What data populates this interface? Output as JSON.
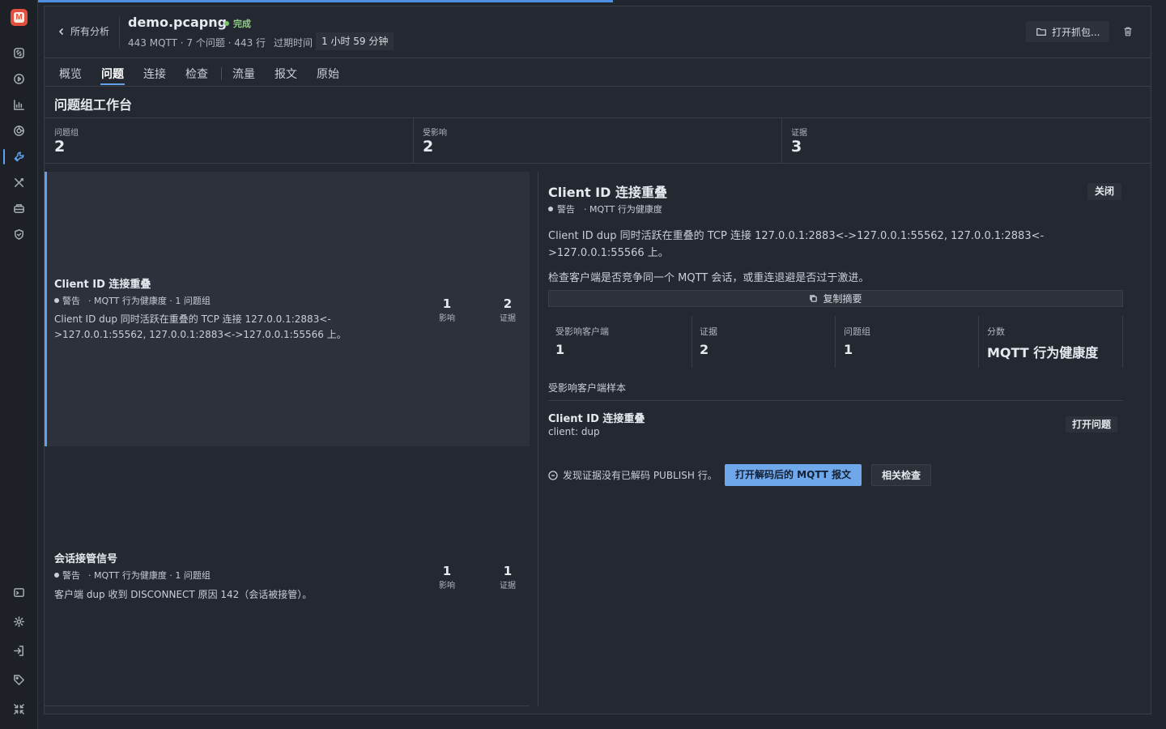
{
  "app": {
    "logo_letter": "M"
  },
  "progress": {
    "fraction": 0.51
  },
  "header": {
    "back_label": "所有分析",
    "file_name": "demo.pcapng",
    "status": "完成",
    "meta": "443 MQTT · 7 个问题 · 443 行",
    "elapsed_label": "过期时间",
    "elapsed_value": "1 小时 59 分钟",
    "open_capture_label": "打开抓包..."
  },
  "tabs": [
    {
      "label": "概览"
    },
    {
      "label": "问题",
      "active": true
    },
    {
      "label": "连接"
    },
    {
      "label": "检查"
    },
    {
      "label": "流量"
    },
    {
      "label": "报文"
    },
    {
      "label": "原始"
    }
  ],
  "page_title": "问题组工作台",
  "stats": [
    {
      "label": "问题组",
      "value": "2"
    },
    {
      "label": "受影响",
      "value": "2"
    },
    {
      "label": "证据",
      "value": "3"
    }
  ],
  "groups": [
    {
      "title": "Client ID 连接重叠",
      "severity": "警告",
      "category": "· MQTT 行为健康度 · 1 问题组",
      "description": "Client ID dup 同时活跃在重叠的 TCP 连接 127.0.0.1:2883<->127.0.0.1:55562, 127.0.0.1:2883<->127.0.0.1:55566 上。",
      "impact": "1",
      "impact_label": "影响",
      "evidence": "2",
      "evidence_label": "证据"
    },
    {
      "title": "会话接管信号",
      "severity": "警告",
      "category": "· MQTT 行为健康度 · 1 问题组",
      "description": "客户端 dup 收到 DISCONNECT 原因 142（会话被接管）。",
      "impact": "1",
      "impact_label": "影响",
      "evidence": "1",
      "evidence_label": "证据"
    }
  ],
  "detail": {
    "title": "Client ID 连接重叠",
    "close_label": "关闭",
    "severity": "警告",
    "category": "· MQTT 行为健康度",
    "description": "Client ID dup 同时活跃在重叠的 TCP 连接 127.0.0.1:2883<->127.0.0.1:55562, 127.0.0.1:2883<->127.0.0.1:55566 上。",
    "advice": "检查客户端是否竞争同一个 MQTT 会话，或重连退避是否过于激进。",
    "copy_label": "复制摘要",
    "stats": [
      {
        "label": "受影响客户端",
        "value": "1"
      },
      {
        "label": "证据",
        "value": "2"
      },
      {
        "label": "问题组",
        "value": "1"
      },
      {
        "label": "分数",
        "value": "MQTT 行为健康度"
      }
    ],
    "sample_label": "受影响客户端样本",
    "sample_title": "Client ID 连接重叠",
    "sample_sub": "client: dup",
    "open_issue_label": "打开问题",
    "notice": "发现证据没有已解码 PUBLISH 行。",
    "primary_label": "打开解码后的 MQTT 报文",
    "secondary_label": "相关检查"
  },
  "colors": {
    "accent": "#62a0ea",
    "success": "#79c26f",
    "background": "#21252e"
  },
  "icons": [
    "link-icon",
    "play-icon",
    "chart-icon",
    "target-icon",
    "wrench-active-icon",
    "tools-icon",
    "database-icon",
    "shield-icon",
    "terminal-icon",
    "gear-icon",
    "login-icon",
    "tag-icon",
    "collapse-icon",
    "chevron-left-icon",
    "folder-icon",
    "trash-icon",
    "copy-icon",
    "info-circle-icon"
  ]
}
